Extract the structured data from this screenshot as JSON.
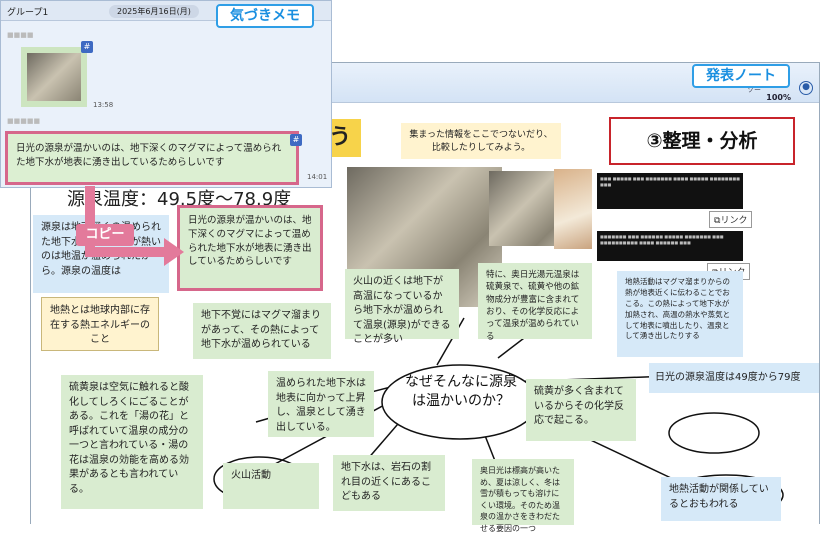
{
  "callouts": {
    "memo": "気づきメモ",
    "presentation": "発表ノート",
    "copy": "コピー"
  },
  "chat": {
    "group": "グループ1",
    "date": "2025年6月16日(月)",
    "blurred_name_1": "■■■■",
    "blurred_name_2": "■■■■■",
    "time_1": "13:58",
    "time_2": "14:01",
    "message": "日光の源泉が温かいのは、地下深くのマグマによって温められた地下水が地表に湧き出しているためらしいです",
    "tag_icon": "#"
  },
  "app": {
    "zoom": "100%",
    "tab_partial": "ソー"
  },
  "board": {
    "title_partial": "う",
    "hint": "集まった情報をここでつないだり、比較したりしてみよう。",
    "stage": "③整理・分析",
    "temperature_partial": "源泉温度：49.5度～78.9度",
    "center": "なぜそんなに源泉は温かいのか？",
    "link_label": "リンク",
    "notes": {
      "copied": "日光の源泉が温かいのは、地下深くのマグマによって温められた地下水が地表に湧き出しているためらしいです",
      "left_partial": "源泉は地下深くの温められた地下水が源泉の水が熱いのは地温が温められたから。源泉の温度は",
      "chinetsu": "地熱とは地球内部に存在する熱エネルギーのこと",
      "sulfur": "硫黄泉は空気に触れると酸化してしろくにごることがある。これを「湯の花」と呼ばれていて温泉の成分の一つと言われている・湯の花は温泉の効能を高める効果があるとも言われている。",
      "volcano": "火山の近くは地下が高温になっているから地下水が温められて温泉(源泉)ができることが多い",
      "okunikko": "特に、奥日光湯元温泉は硫黄泉で、硫黄や他の鉱物成分が豊富に含まれており、その化学反応によって温泉が温められている",
      "fault": "地下不覚にはマグマ溜まりがあって、その熱によって地下水が温められている",
      "warmed": "温められた地下水は地表に向かって上昇し、温泉として湧き出している。",
      "sulfur2": "硫黄が多く含まれているからその化学反応で起こる。",
      "crack": "地下水は、岩石の割れ目の近くにあるこどもある",
      "winter": "奥日光は標高が高いため、夏は涼しく、冬は雪が積もっても溶けにくい環境。そのため温泉の温かさをきわだたせる要因の一つ",
      "geo_blue": "地熱活動はマグマ溜まりからの熱が地表近くに伝わることでおこる。この熱によって地下水が加熱され、高温の熱水や蒸気として地表に噴出したり、温泉として湧き出したりする",
      "nikko_temp": "日光の源泉温度は49度から79度",
      "volcanic": "火山活動",
      "geo_related": "地熱活動が関係しているとおもわれる",
      "dark1": "■■■ ■■■■■ ■■■ ■■■■■■■ ■■■■ ■■■■■ ■■■■■■■■ ■■■",
      "dark2": "■■■■■■■ ■■■ ■■■■■■ ■■■■■ ■■■■■■■ ■■■ ■■■■■■■■■■ ■■■■ ■■■■■■ ■■■"
    }
  }
}
